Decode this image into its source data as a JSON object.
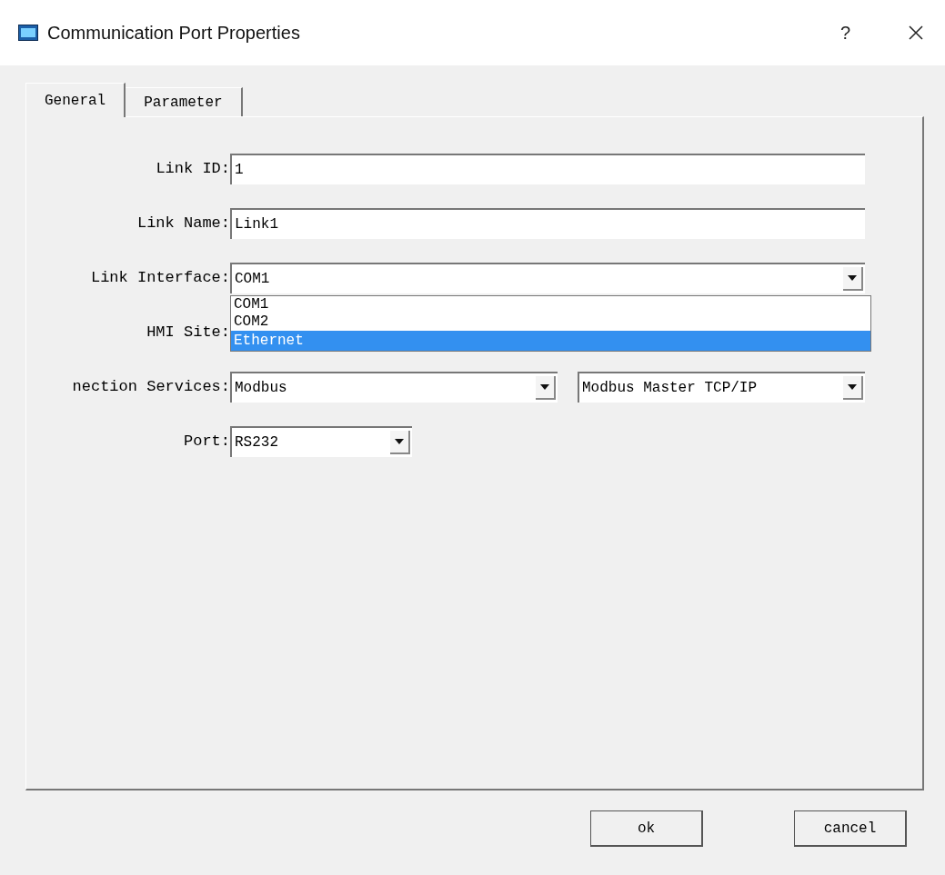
{
  "window": {
    "title": "Communication Port Properties",
    "help": "?"
  },
  "tabs": [
    {
      "label": "General",
      "selected": true
    },
    {
      "label": "Parameter",
      "selected": false
    }
  ],
  "fields": [
    {
      "kind": "text",
      "label": "Link ID:",
      "value": "1"
    },
    {
      "kind": "text",
      "label": "Link Name:",
      "value": "Link1"
    },
    {
      "kind": "select",
      "label": "Link Interface:",
      "value": "COM1",
      "expanded": true,
      "options": [
        {
          "label": "COM1",
          "highlighted": false
        },
        {
          "label": "COM2",
          "highlighted": false
        },
        {
          "label": "Ethernet",
          "highlighted": true
        }
      ]
    },
    {
      "kind": "covered",
      "label": "HMI Site:"
    },
    {
      "kind": "select_pair",
      "label": "nection Services:",
      "values": [
        "Modbus",
        "Modbus Master TCP/IP"
      ]
    },
    {
      "kind": "select_short",
      "label": "Port:",
      "value": "RS232"
    }
  ],
  "buttons": [
    "ok",
    "cancel"
  ]
}
